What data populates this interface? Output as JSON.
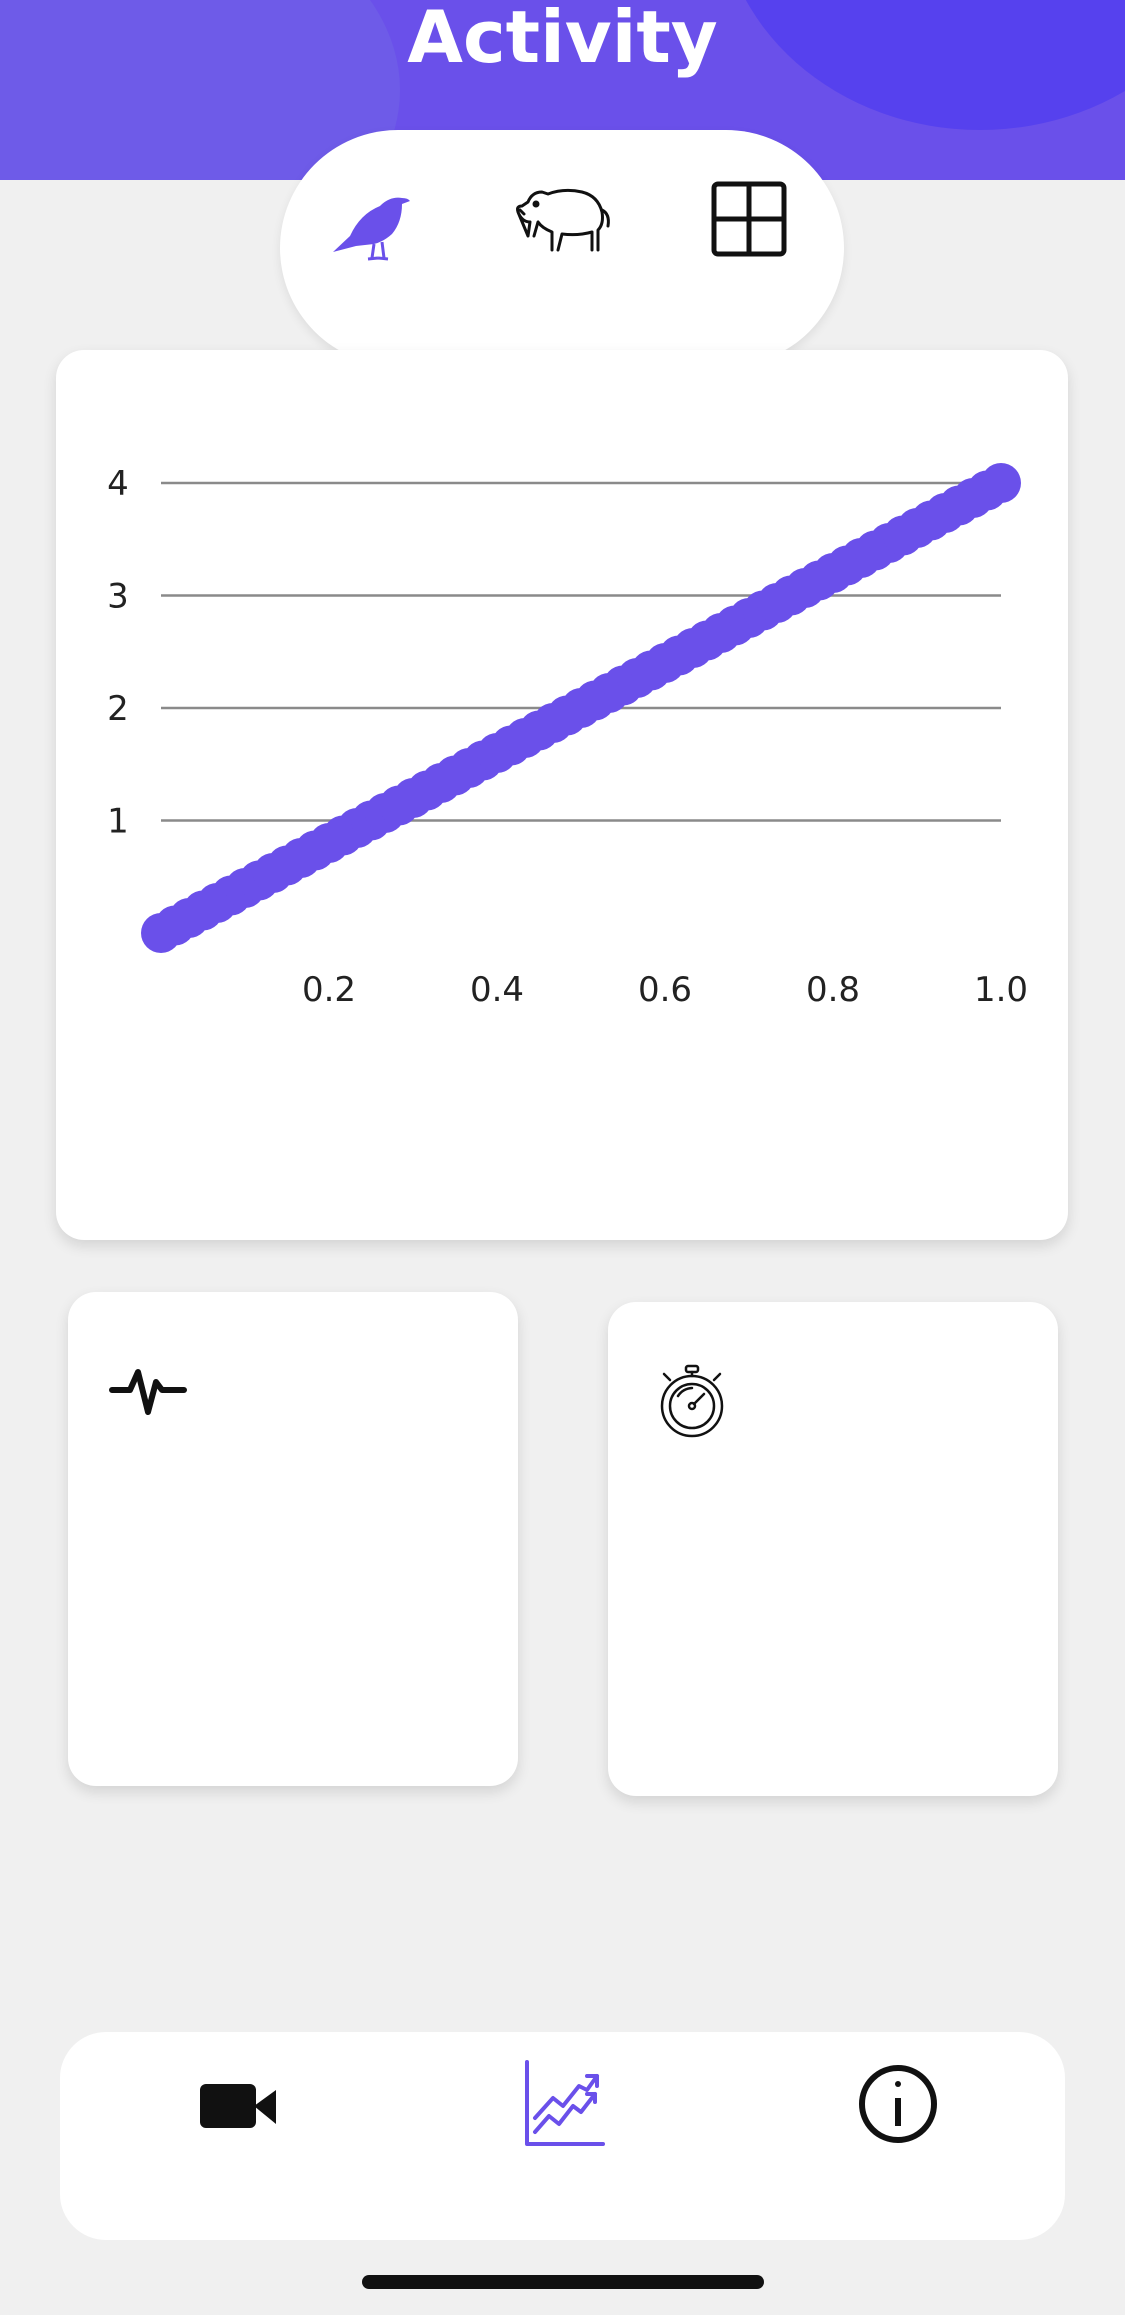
{
  "header": {
    "title": "Activity",
    "color": "#6a50ea"
  },
  "segments": [
    {
      "icon": "crow-icon",
      "selected": true
    },
    {
      "icon": "boar-icon",
      "selected": false
    },
    {
      "icon": "grid-icon",
      "selected": false
    }
  ],
  "chart_data": {
    "type": "line",
    "x": [
      0.0,
      1.0
    ],
    "y": [
      0,
      4
    ],
    "series": [
      {
        "x": [
          0.0,
          1.0
        ],
        "values": [
          0,
          4
        ]
      }
    ],
    "xticks": [
      0.2,
      0.4,
      0.6,
      0.8,
      1.0
    ],
    "xtick_labels": [
      "0.2",
      "0.4",
      "0.6",
      "0.8",
      "1.0"
    ],
    "yticks": [
      1,
      2,
      3,
      4
    ],
    "ytick_labels": [
      "1",
      "2",
      "3",
      "4"
    ],
    "xlim": [
      0.0,
      1.0
    ],
    "ylim": [
      0,
      4
    ],
    "grid": "horizontal",
    "title": "",
    "xlabel": "",
    "ylabel": "",
    "color": "#6a50ea"
  },
  "cards": [
    {
      "icon": "heartbeat-icon"
    },
    {
      "icon": "stopwatch-icon"
    }
  ],
  "nav": [
    {
      "icon": "video-camera-icon",
      "selected": false
    },
    {
      "icon": "chart-icon",
      "selected": true
    },
    {
      "icon": "info-icon",
      "selected": false
    }
  ]
}
